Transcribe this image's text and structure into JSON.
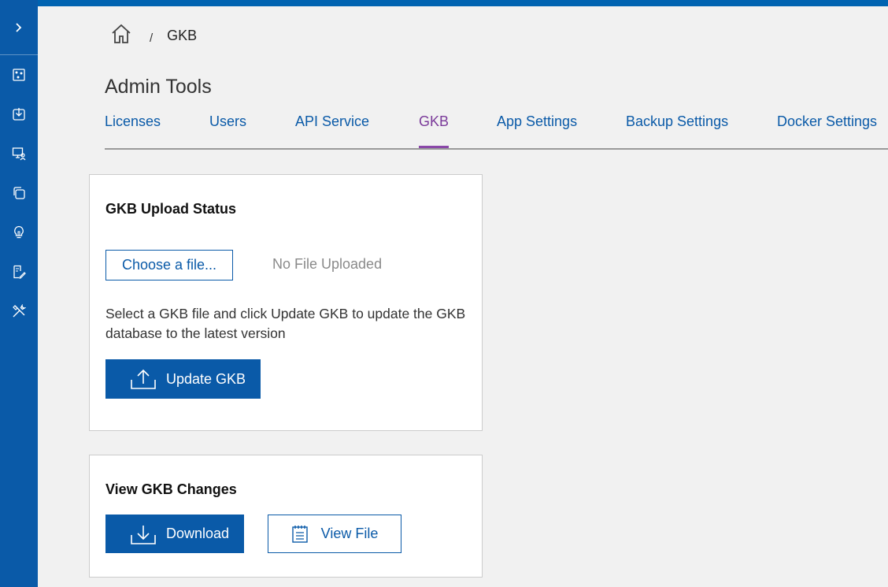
{
  "sidebar": {
    "toggle_icon": "chevron-right-icon",
    "items": [
      {
        "icon": "dashboard-icon"
      },
      {
        "icon": "download-tray-icon"
      },
      {
        "icon": "monitor-users-icon"
      },
      {
        "icon": "copy-stack-icon"
      },
      {
        "icon": "lightbulb-icon"
      },
      {
        "icon": "document-edit-icon"
      },
      {
        "icon": "tools-icon"
      }
    ]
  },
  "breadcrumb": {
    "home_icon": "home-icon",
    "separator": "/",
    "current": "GKB"
  },
  "page": {
    "title": "Admin Tools"
  },
  "tabs": [
    {
      "label": "Licenses",
      "active": false
    },
    {
      "label": "Users",
      "active": false
    },
    {
      "label": "API Service",
      "active": false
    },
    {
      "label": "GKB",
      "active": true
    },
    {
      "label": "App Settings",
      "active": false
    },
    {
      "label": "Backup Settings",
      "active": false
    },
    {
      "label": "Docker Settings",
      "active": false
    }
  ],
  "upload_card": {
    "title": "GKB Upload Status",
    "choose_file_label": "Choose a file...",
    "file_status": "No File Uploaded",
    "help_text": "Select a GKB file and click Update GKB to update the GKB database to the latest version",
    "update_button_label": "Update GKB",
    "update_icon": "upload-icon"
  },
  "changes_card": {
    "title": "View GKB Changes",
    "download_label": "Download",
    "download_icon": "download-icon",
    "view_file_label": "View File",
    "view_file_icon": "notepad-icon"
  },
  "colors": {
    "primary": "#0a5aa8",
    "active_tab": "#7b3b9a",
    "background": "#f1f1f1"
  }
}
